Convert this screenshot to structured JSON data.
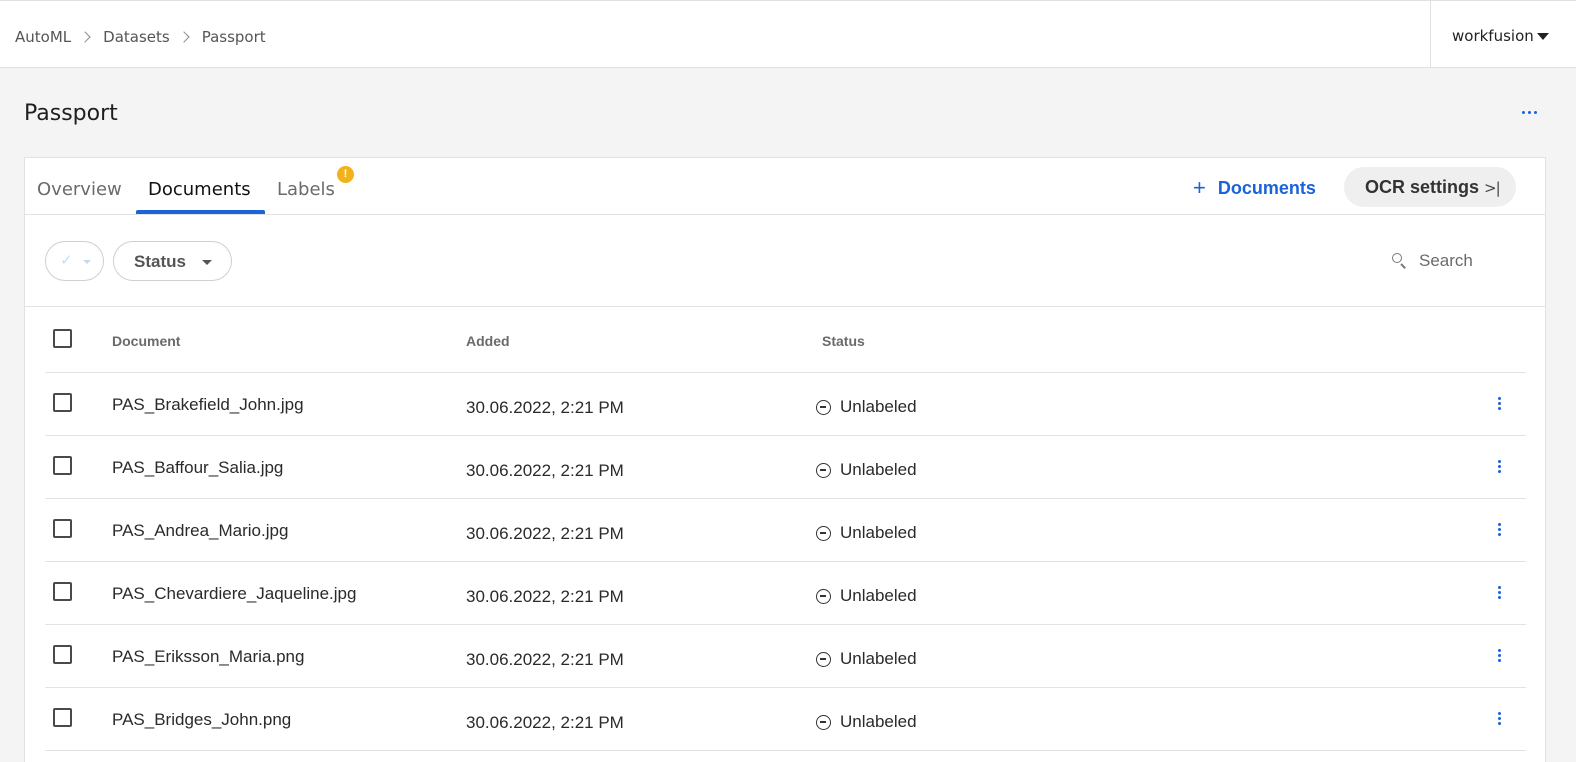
{
  "breadcrumb": [
    "AutoML",
    "Datasets",
    "Passport"
  ],
  "user": {
    "name": "workfusion"
  },
  "page": {
    "title": "Passport"
  },
  "tabs": [
    {
      "label": "Overview"
    },
    {
      "label": "Documents"
    },
    {
      "label": "Labels",
      "badge": "!"
    }
  ],
  "actions": {
    "add_documents_label": "Documents",
    "ocr_settings_label": "OCR settings"
  },
  "filters": {
    "status_label": "Status",
    "search_placeholder": "Search"
  },
  "table": {
    "headers": {
      "document": "Document",
      "added": "Added",
      "status": "Status"
    },
    "rows": [
      {
        "document": "PAS_Brakefield_John.jpg",
        "added": "30.06.2022, 2:21 PM",
        "status": "Unlabeled"
      },
      {
        "document": "PAS_Baffour_Salia.jpg",
        "added": "30.06.2022, 2:21 PM",
        "status": "Unlabeled"
      },
      {
        "document": "PAS_Andrea_Mario.jpg",
        "added": "30.06.2022, 2:21 PM",
        "status": "Unlabeled"
      },
      {
        "document": "PAS_Chevardiere_Jaqueline.jpg",
        "added": "30.06.2022, 2:21 PM",
        "status": "Unlabeled"
      },
      {
        "document": "PAS_Eriksson_Maria.png",
        "added": "30.06.2022, 2:21 PM",
        "status": "Unlabeled"
      },
      {
        "document": "PAS_Bridges_John.png",
        "added": "30.06.2022, 2:21 PM",
        "status": "Unlabeled"
      }
    ]
  },
  "colors": {
    "accent": "#1a63d8",
    "badge": "#f2b21c",
    "background": "#f4f4f4"
  },
  "icons": [
    "chevron-right-icon",
    "caret-down-icon",
    "more-horizontal-icon",
    "plus-icon",
    "collapse-panel-icon",
    "check-icon",
    "search-icon",
    "minus-circle-icon",
    "more-vertical-icon"
  ]
}
